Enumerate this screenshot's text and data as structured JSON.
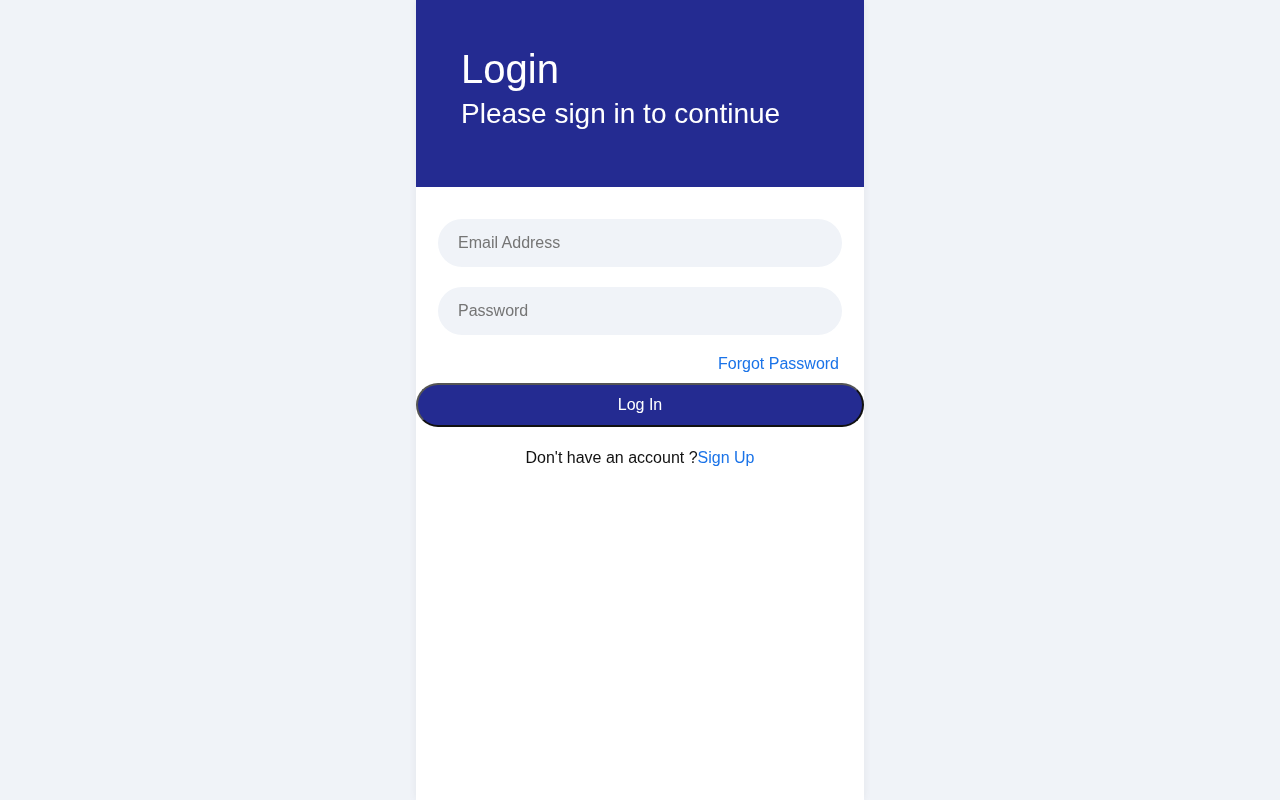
{
  "header": {
    "title": "Login",
    "subtitle": "Please sign in to continue"
  },
  "fields": [
    {
      "placeholder": "Email Address"
    },
    {
      "placeholder": "Password"
    }
  ],
  "forgot_link": "Forgot Password",
  "login_button": "Log In",
  "signup": {
    "prompt": "Don't have an account ?",
    "link": "Sign Up"
  }
}
